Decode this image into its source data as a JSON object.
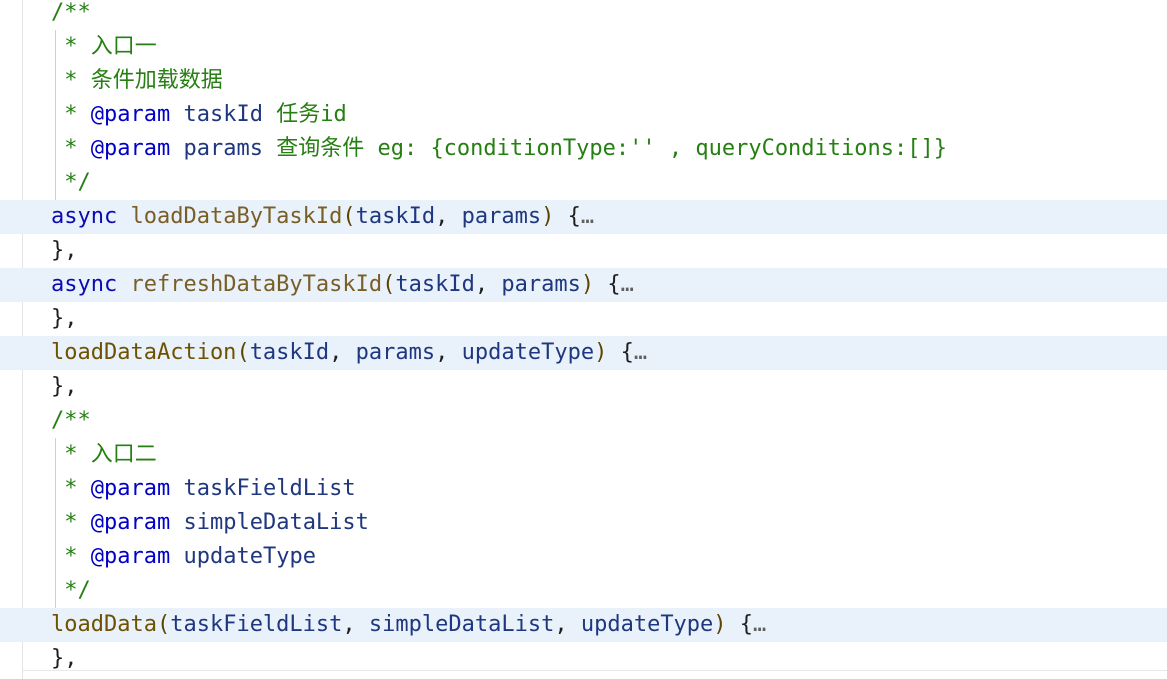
{
  "editor": {
    "lines": [
      {
        "parts": [
          {
            "t": "/**",
            "c": "comment"
          }
        ]
      },
      {
        "doc": true,
        "parts": [
          {
            "t": " * 入口一",
            "c": "comment"
          }
        ]
      },
      {
        "doc": true,
        "parts": [
          {
            "t": " * 条件加载数据",
            "c": "comment"
          }
        ]
      },
      {
        "doc": true,
        "parts": [
          {
            "t": " * ",
            "c": "comment"
          },
          {
            "t": "@param",
            "c": "tag"
          },
          {
            "t": " ",
            "c": "comment"
          },
          {
            "t": "taskId",
            "c": "param"
          },
          {
            "t": " 任务id",
            "c": "comment"
          }
        ]
      },
      {
        "doc": true,
        "parts": [
          {
            "t": " * ",
            "c": "comment"
          },
          {
            "t": "@param",
            "c": "tag"
          },
          {
            "t": " ",
            "c": "comment"
          },
          {
            "t": "params",
            "c": "param"
          },
          {
            "t": " 查询条件 eg: {conditionType:'' , queryConditions:[]}",
            "c": "comment"
          }
        ]
      },
      {
        "doc": true,
        "parts": [
          {
            "t": " */",
            "c": "comment"
          }
        ]
      },
      {
        "folded": true,
        "parts": [
          {
            "t": "async",
            "c": "kw"
          },
          {
            "t": " ",
            "c": "punct"
          },
          {
            "t": "loadDataByTaskId",
            "c": "fn"
          },
          {
            "t": "(",
            "c": "paren"
          },
          {
            "t": "taskId",
            "c": "ident"
          },
          {
            "t": ", ",
            "c": "punct"
          },
          {
            "t": "params",
            "c": "ident"
          },
          {
            "t": ")",
            "c": "paren"
          },
          {
            "t": " {",
            "c": "punct"
          },
          {
            "t": "…",
            "c": "ellipsis"
          }
        ]
      },
      {
        "parts": [
          {
            "t": "},",
            "c": "punct"
          }
        ]
      },
      {
        "folded": true,
        "parts": [
          {
            "t": "async",
            "c": "kw"
          },
          {
            "t": " ",
            "c": "punct"
          },
          {
            "t": "refreshDataByTaskId",
            "c": "fn"
          },
          {
            "t": "(",
            "c": "paren"
          },
          {
            "t": "taskId",
            "c": "ident"
          },
          {
            "t": ", ",
            "c": "punct"
          },
          {
            "t": "params",
            "c": "ident"
          },
          {
            "t": ")",
            "c": "paren"
          },
          {
            "t": " {",
            "c": "punct"
          },
          {
            "t": "…",
            "c": "ellipsis"
          }
        ]
      },
      {
        "parts": [
          {
            "t": "},",
            "c": "punct"
          }
        ]
      },
      {
        "folded": true,
        "parts": [
          {
            "t": "loadDataAction",
            "c": "fn2"
          },
          {
            "t": "(",
            "c": "paren"
          },
          {
            "t": "taskId",
            "c": "ident"
          },
          {
            "t": ", ",
            "c": "punct"
          },
          {
            "t": "params",
            "c": "ident"
          },
          {
            "t": ", ",
            "c": "punct"
          },
          {
            "t": "updateType",
            "c": "ident"
          },
          {
            "t": ")",
            "c": "paren"
          },
          {
            "t": " {",
            "c": "punct"
          },
          {
            "t": "…",
            "c": "ellipsis"
          }
        ]
      },
      {
        "parts": [
          {
            "t": "},",
            "c": "punct"
          }
        ]
      },
      {
        "parts": [
          {
            "t": "/**",
            "c": "comment"
          }
        ]
      },
      {
        "doc": true,
        "parts": [
          {
            "t": " * 入口二",
            "c": "comment"
          }
        ]
      },
      {
        "doc": true,
        "parts": [
          {
            "t": " * ",
            "c": "comment"
          },
          {
            "t": "@param",
            "c": "tag"
          },
          {
            "t": " ",
            "c": "comment"
          },
          {
            "t": "taskFieldList",
            "c": "param"
          }
        ]
      },
      {
        "doc": true,
        "parts": [
          {
            "t": " * ",
            "c": "comment"
          },
          {
            "t": "@param",
            "c": "tag"
          },
          {
            "t": " ",
            "c": "comment"
          },
          {
            "t": "simpleDataList",
            "c": "param"
          }
        ]
      },
      {
        "doc": true,
        "parts": [
          {
            "t": " * ",
            "c": "comment"
          },
          {
            "t": "@param",
            "c": "tag"
          },
          {
            "t": " ",
            "c": "comment"
          },
          {
            "t": "updateType",
            "c": "param"
          }
        ]
      },
      {
        "doc": true,
        "parts": [
          {
            "t": " */",
            "c": "comment"
          }
        ]
      },
      {
        "folded": true,
        "parts": [
          {
            "t": "loadData",
            "c": "fn2"
          },
          {
            "t": "(",
            "c": "paren"
          },
          {
            "t": "taskFieldList",
            "c": "ident"
          },
          {
            "t": ", ",
            "c": "punct"
          },
          {
            "t": "simpleDataList",
            "c": "ident"
          },
          {
            "t": ", ",
            "c": "punct"
          },
          {
            "t": "updateType",
            "c": "ident"
          },
          {
            "t": ")",
            "c": "paren"
          },
          {
            "t": " {",
            "c": "punct"
          },
          {
            "t": "…",
            "c": "ellipsis"
          }
        ]
      },
      {
        "parts": [
          {
            "t": "},",
            "c": "punct"
          }
        ]
      }
    ]
  }
}
